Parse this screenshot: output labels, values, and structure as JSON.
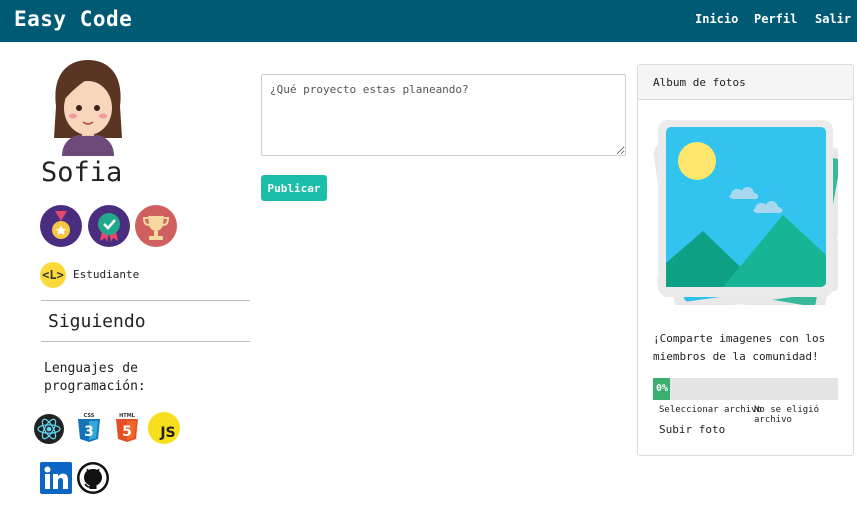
{
  "brand": "Easy Code",
  "nav": {
    "home": "Inicio",
    "profile": "Perfil",
    "logout": "Salir"
  },
  "colors": {
    "navbar": "#005a73",
    "publish": "#1bbfa9",
    "progress": "#3aaf6f"
  },
  "profile": {
    "name": "Sofia",
    "badges": [
      "medal-icon",
      "ribbon-icon",
      "trophy-icon"
    ],
    "level_short": "<L>",
    "level_label": "Estudiante",
    "following": "Siguiendo",
    "languages_title": "Lenguajes de programación:",
    "languages": [
      "react-icon",
      "css3-icon",
      "html5-icon",
      "javascript-icon"
    ],
    "social": [
      "linkedin-icon",
      "github-icon"
    ]
  },
  "post": {
    "placeholder": "¿Qué proyecto estas planeando?",
    "publish_label": "Publicar"
  },
  "album": {
    "title": "Album de fotos",
    "description": "¡Comparte imagenes con los miembros de la comunidad!",
    "progress_label": "0%",
    "progress_value": 0,
    "choose_file": "Seleccionar archivo",
    "file_status": "No se eligió archivo",
    "upload_label": "Subir foto"
  }
}
